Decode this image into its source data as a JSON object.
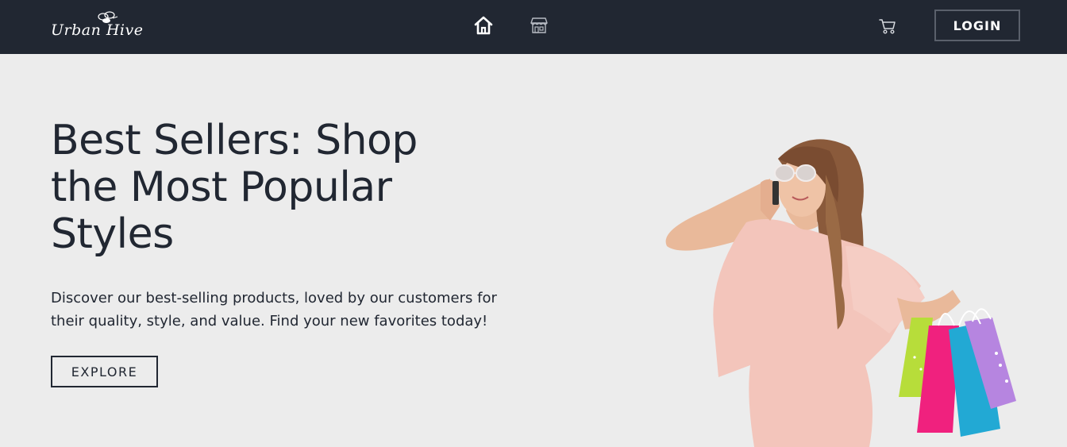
{
  "navbar": {
    "logo_text": "Urban Hive",
    "nav_items": [
      {
        "icon": "home-icon",
        "active": true
      },
      {
        "icon": "shop-icon",
        "active": false
      }
    ],
    "cart_icon": "cart-icon",
    "login_label": "LOGIN"
  },
  "hero": {
    "title": "Best Sellers: Shop the Most Popular Styles",
    "description": "Discover our best-selling products, loved by our customers for their quality, style, and value. Find your new favorites today!",
    "cta_label": "EXPLORE",
    "image_subject": "woman-with-shopping-bags"
  },
  "colors": {
    "navbar_bg": "#212732",
    "page_bg": "#ececec",
    "text_dark": "#212732",
    "nav_text": "#ffffff"
  }
}
